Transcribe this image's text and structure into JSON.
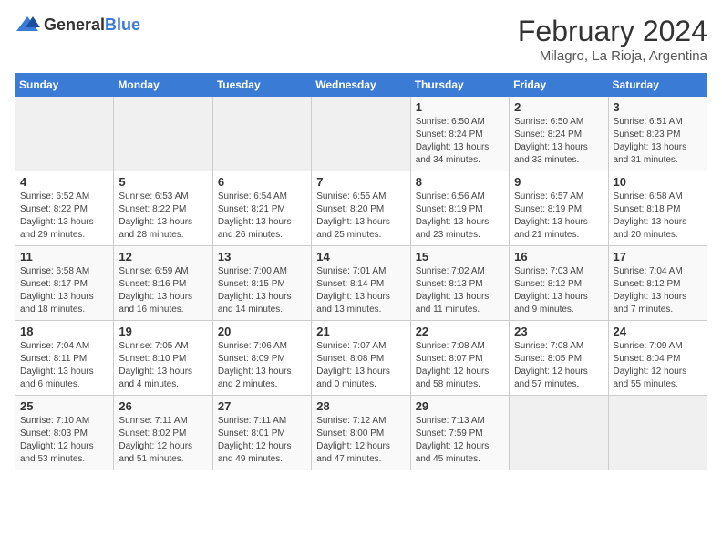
{
  "header": {
    "logo_general": "General",
    "logo_blue": "Blue",
    "title": "February 2024",
    "subtitle": "Milagro, La Rioja, Argentina"
  },
  "days_of_week": [
    "Sunday",
    "Monday",
    "Tuesday",
    "Wednesday",
    "Thursday",
    "Friday",
    "Saturday"
  ],
  "weeks": [
    [
      {
        "day": "",
        "info": ""
      },
      {
        "day": "",
        "info": ""
      },
      {
        "day": "",
        "info": ""
      },
      {
        "day": "",
        "info": ""
      },
      {
        "day": "1",
        "info": "Sunrise: 6:50 AM\nSunset: 8:24 PM\nDaylight: 13 hours\nand 34 minutes."
      },
      {
        "day": "2",
        "info": "Sunrise: 6:50 AM\nSunset: 8:24 PM\nDaylight: 13 hours\nand 33 minutes."
      },
      {
        "day": "3",
        "info": "Sunrise: 6:51 AM\nSunset: 8:23 PM\nDaylight: 13 hours\nand 31 minutes."
      }
    ],
    [
      {
        "day": "4",
        "info": "Sunrise: 6:52 AM\nSunset: 8:22 PM\nDaylight: 13 hours\nand 29 minutes."
      },
      {
        "day": "5",
        "info": "Sunrise: 6:53 AM\nSunset: 8:22 PM\nDaylight: 13 hours\nand 28 minutes."
      },
      {
        "day": "6",
        "info": "Sunrise: 6:54 AM\nSunset: 8:21 PM\nDaylight: 13 hours\nand 26 minutes."
      },
      {
        "day": "7",
        "info": "Sunrise: 6:55 AM\nSunset: 8:20 PM\nDaylight: 13 hours\nand 25 minutes."
      },
      {
        "day": "8",
        "info": "Sunrise: 6:56 AM\nSunset: 8:19 PM\nDaylight: 13 hours\nand 23 minutes."
      },
      {
        "day": "9",
        "info": "Sunrise: 6:57 AM\nSunset: 8:19 PM\nDaylight: 13 hours\nand 21 minutes."
      },
      {
        "day": "10",
        "info": "Sunrise: 6:58 AM\nSunset: 8:18 PM\nDaylight: 13 hours\nand 20 minutes."
      }
    ],
    [
      {
        "day": "11",
        "info": "Sunrise: 6:58 AM\nSunset: 8:17 PM\nDaylight: 13 hours\nand 18 minutes."
      },
      {
        "day": "12",
        "info": "Sunrise: 6:59 AM\nSunset: 8:16 PM\nDaylight: 13 hours\nand 16 minutes."
      },
      {
        "day": "13",
        "info": "Sunrise: 7:00 AM\nSunset: 8:15 PM\nDaylight: 13 hours\nand 14 minutes."
      },
      {
        "day": "14",
        "info": "Sunrise: 7:01 AM\nSunset: 8:14 PM\nDaylight: 13 hours\nand 13 minutes."
      },
      {
        "day": "15",
        "info": "Sunrise: 7:02 AM\nSunset: 8:13 PM\nDaylight: 13 hours\nand 11 minutes."
      },
      {
        "day": "16",
        "info": "Sunrise: 7:03 AM\nSunset: 8:12 PM\nDaylight: 13 hours\nand 9 minutes."
      },
      {
        "day": "17",
        "info": "Sunrise: 7:04 AM\nSunset: 8:12 PM\nDaylight: 13 hours\nand 7 minutes."
      }
    ],
    [
      {
        "day": "18",
        "info": "Sunrise: 7:04 AM\nSunset: 8:11 PM\nDaylight: 13 hours\nand 6 minutes."
      },
      {
        "day": "19",
        "info": "Sunrise: 7:05 AM\nSunset: 8:10 PM\nDaylight: 13 hours\nand 4 minutes."
      },
      {
        "day": "20",
        "info": "Sunrise: 7:06 AM\nSunset: 8:09 PM\nDaylight: 13 hours\nand 2 minutes."
      },
      {
        "day": "21",
        "info": "Sunrise: 7:07 AM\nSunset: 8:08 PM\nDaylight: 13 hours\nand 0 minutes."
      },
      {
        "day": "22",
        "info": "Sunrise: 7:08 AM\nSunset: 8:07 PM\nDaylight: 12 hours\nand 58 minutes."
      },
      {
        "day": "23",
        "info": "Sunrise: 7:08 AM\nSunset: 8:05 PM\nDaylight: 12 hours\nand 57 minutes."
      },
      {
        "day": "24",
        "info": "Sunrise: 7:09 AM\nSunset: 8:04 PM\nDaylight: 12 hours\nand 55 minutes."
      }
    ],
    [
      {
        "day": "25",
        "info": "Sunrise: 7:10 AM\nSunset: 8:03 PM\nDaylight: 12 hours\nand 53 minutes."
      },
      {
        "day": "26",
        "info": "Sunrise: 7:11 AM\nSunset: 8:02 PM\nDaylight: 12 hours\nand 51 minutes."
      },
      {
        "day": "27",
        "info": "Sunrise: 7:11 AM\nSunset: 8:01 PM\nDaylight: 12 hours\nand 49 minutes."
      },
      {
        "day": "28",
        "info": "Sunrise: 7:12 AM\nSunset: 8:00 PM\nDaylight: 12 hours\nand 47 minutes."
      },
      {
        "day": "29",
        "info": "Sunrise: 7:13 AM\nSunset: 7:59 PM\nDaylight: 12 hours\nand 45 minutes."
      },
      {
        "day": "",
        "info": ""
      },
      {
        "day": "",
        "info": ""
      }
    ]
  ]
}
